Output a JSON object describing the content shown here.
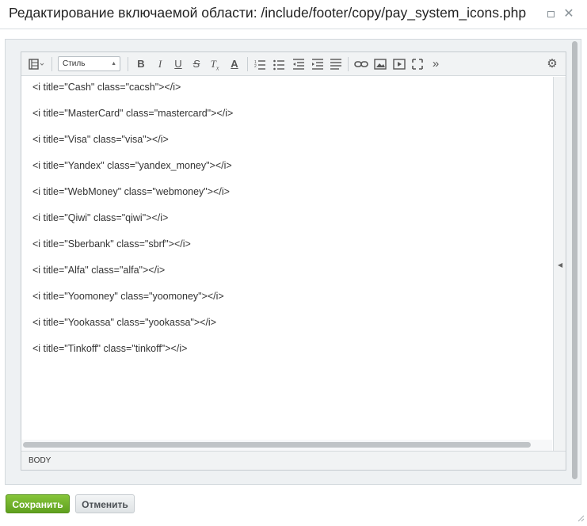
{
  "dialog": {
    "title": "Редактирование включаемой области: /include/footer/copy/pay_system_icons.php",
    "minimize_icon": "minimize-icon",
    "close_icon": "close-icon"
  },
  "toolbar": {
    "style_select": {
      "value": "Стиль"
    },
    "buttons": [
      {
        "name": "mode-switch-icon",
        "glyph": "▤"
      },
      {
        "name": "bold-icon",
        "glyph": "B"
      },
      {
        "name": "italic-icon",
        "glyph": "I"
      },
      {
        "name": "underline-icon",
        "glyph": "U"
      },
      {
        "name": "strikethrough-icon",
        "glyph": "S"
      },
      {
        "name": "remove-format-icon",
        "glyph": "Tx"
      },
      {
        "name": "font-color-icon",
        "glyph": "A"
      },
      {
        "name": "ordered-list-icon",
        "glyph": "≡"
      },
      {
        "name": "unordered-list-icon",
        "glyph": "≡"
      },
      {
        "name": "outdent-icon",
        "glyph": "⇤"
      },
      {
        "name": "indent-icon",
        "glyph": "⇥"
      },
      {
        "name": "align-icon",
        "glyph": "≡"
      },
      {
        "name": "link-icon",
        "glyph": "∞"
      },
      {
        "name": "image-icon",
        "glyph": "▣"
      },
      {
        "name": "video-icon",
        "glyph": "▶"
      },
      {
        "name": "fullscreen-icon",
        "glyph": "⤢"
      },
      {
        "name": "more-icon",
        "glyph": "»"
      },
      {
        "name": "settings-icon",
        "glyph": "⚙"
      }
    ]
  },
  "content": {
    "lines": [
      "<i title=\"Cash\" class=\"cacsh\"></i>",
      "<i title=\"MasterCard\" class=\"mastercard\"></i>",
      "<i title=\"Visa\" class=\"visa\"></i>",
      "<i title=\"Yandex\" class=\"yandex_money\"></i>",
      "<i title=\"WebMoney\" class=\"webmoney\"></i>",
      "<i title=\"Qiwi\" class=\"qiwi\"></i>",
      "<i title=\"Sberbank\" class=\"sbrf\"></i>",
      "<i title=\"Alfa\" class=\"alfa\"></i>",
      "<i title=\"Yoomoney\" class=\"yoomoney\"></i>",
      "<i title=\"Yookassa\" class=\"yookassa\"></i>",
      "<i title=\"Tinkoff\" class=\"tinkoff\"></i>"
    ]
  },
  "statusbar": {
    "path": "BODY"
  },
  "footer": {
    "save_label": "Сохранить",
    "cancel_label": "Отменить"
  },
  "colors": {
    "save_button": "#6cb02a",
    "cancel_button": "#e6e9eb"
  }
}
